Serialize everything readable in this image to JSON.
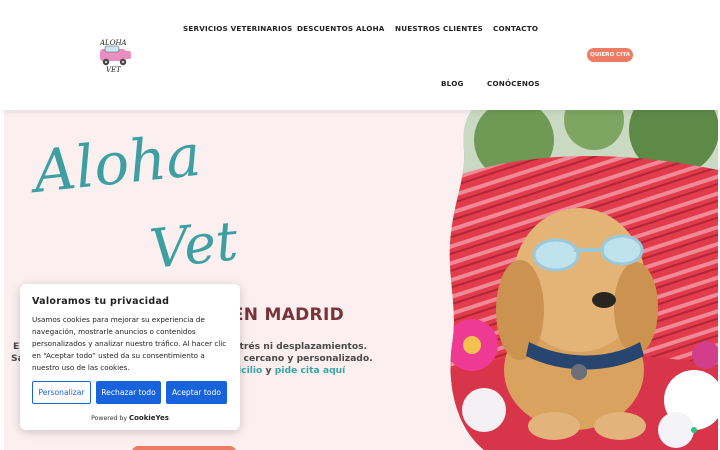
{
  "nav": {
    "logo_alt": "Aloha Vet",
    "items": [
      {
        "label": "SERVICIOS VETERINARIOS"
      },
      {
        "label": "DESCUENTOS ALOHA"
      },
      {
        "label": "NUESTROS CLIENTES"
      },
      {
        "label": "CONTACTO"
      },
      {
        "label": "BLOG"
      },
      {
        "label": "CONÓCENOS"
      }
    ],
    "cta_label": "QUIERO CITA"
  },
  "hero": {
    "script_line1": "Aloha",
    "script_line2": "Vet",
    "title_fragment": "D EN MADRID",
    "line1_left": "E",
    "line1_fragment": "strés ni desplazamientos.",
    "line2_left": "Sa",
    "line2_fragment": "o cercano y personalizado.",
    "line3_link1": "icilio",
    "line3_mid": " y ",
    "line3_link2": "pide cita aquí",
    "photo_subject": "dog-in-hammock-with-sunglasses"
  },
  "cookie": {
    "title": "Valoramos tu privacidad",
    "body": "Usamos cookies para mejorar su experiencia de navegación, mostrarle anuncios o contenidos personalizados y analizar nuestro tráfico. Al hacer clic en “Aceptar todo” usted da su consentimiento a nuestro uso de las cookies.",
    "customize_label": "Personalizar",
    "reject_label": "Rechazar todo",
    "accept_label": "Aceptar todo",
    "powered_prefix": "Powered by",
    "powered_brand": "CookieYes"
  },
  "colors": {
    "accent": "#ee7b63",
    "teal": "#3aa6a8",
    "title": "#7a3239",
    "hero_bg": "#fbeff0",
    "button_blue": "#1863dc"
  }
}
